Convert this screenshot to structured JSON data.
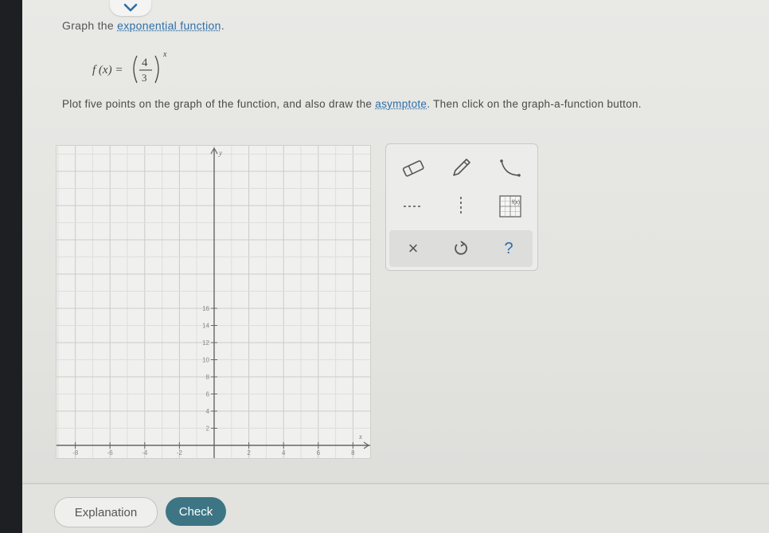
{
  "prompt": {
    "text": "Graph the",
    "link": "exponential function",
    "end": "."
  },
  "formula": {
    "lhs": "f (x) =",
    "numerator": "4",
    "denominator": "3",
    "exponent": "x"
  },
  "instruction": {
    "before": "Plot five points on the graph of the function, and also draw the",
    "link": "asymptote",
    "after": ". Then click on the graph-a-function button."
  },
  "graph": {
    "x_ticks": [
      "-8",
      "-6",
      "-4",
      "-2",
      "2",
      "4",
      "6",
      "8"
    ],
    "y_ticks": [
      "2",
      "4",
      "6",
      "8",
      "10",
      "12",
      "14",
      "16"
    ],
    "x_label": "x",
    "y_label": "y"
  },
  "toolbox": {
    "icons": [
      "eraser-icon",
      "pencil-icon",
      "curve-tool-icon",
      "dashed-horizontal-line-icon",
      "dashed-vertical-line-icon",
      "graph-a-function-icon",
      "clear-icon",
      "undo-icon",
      "help-icon"
    ],
    "clear": "×",
    "help": "?"
  },
  "buttons": {
    "explanation": "Explanation",
    "check": "Check"
  }
}
